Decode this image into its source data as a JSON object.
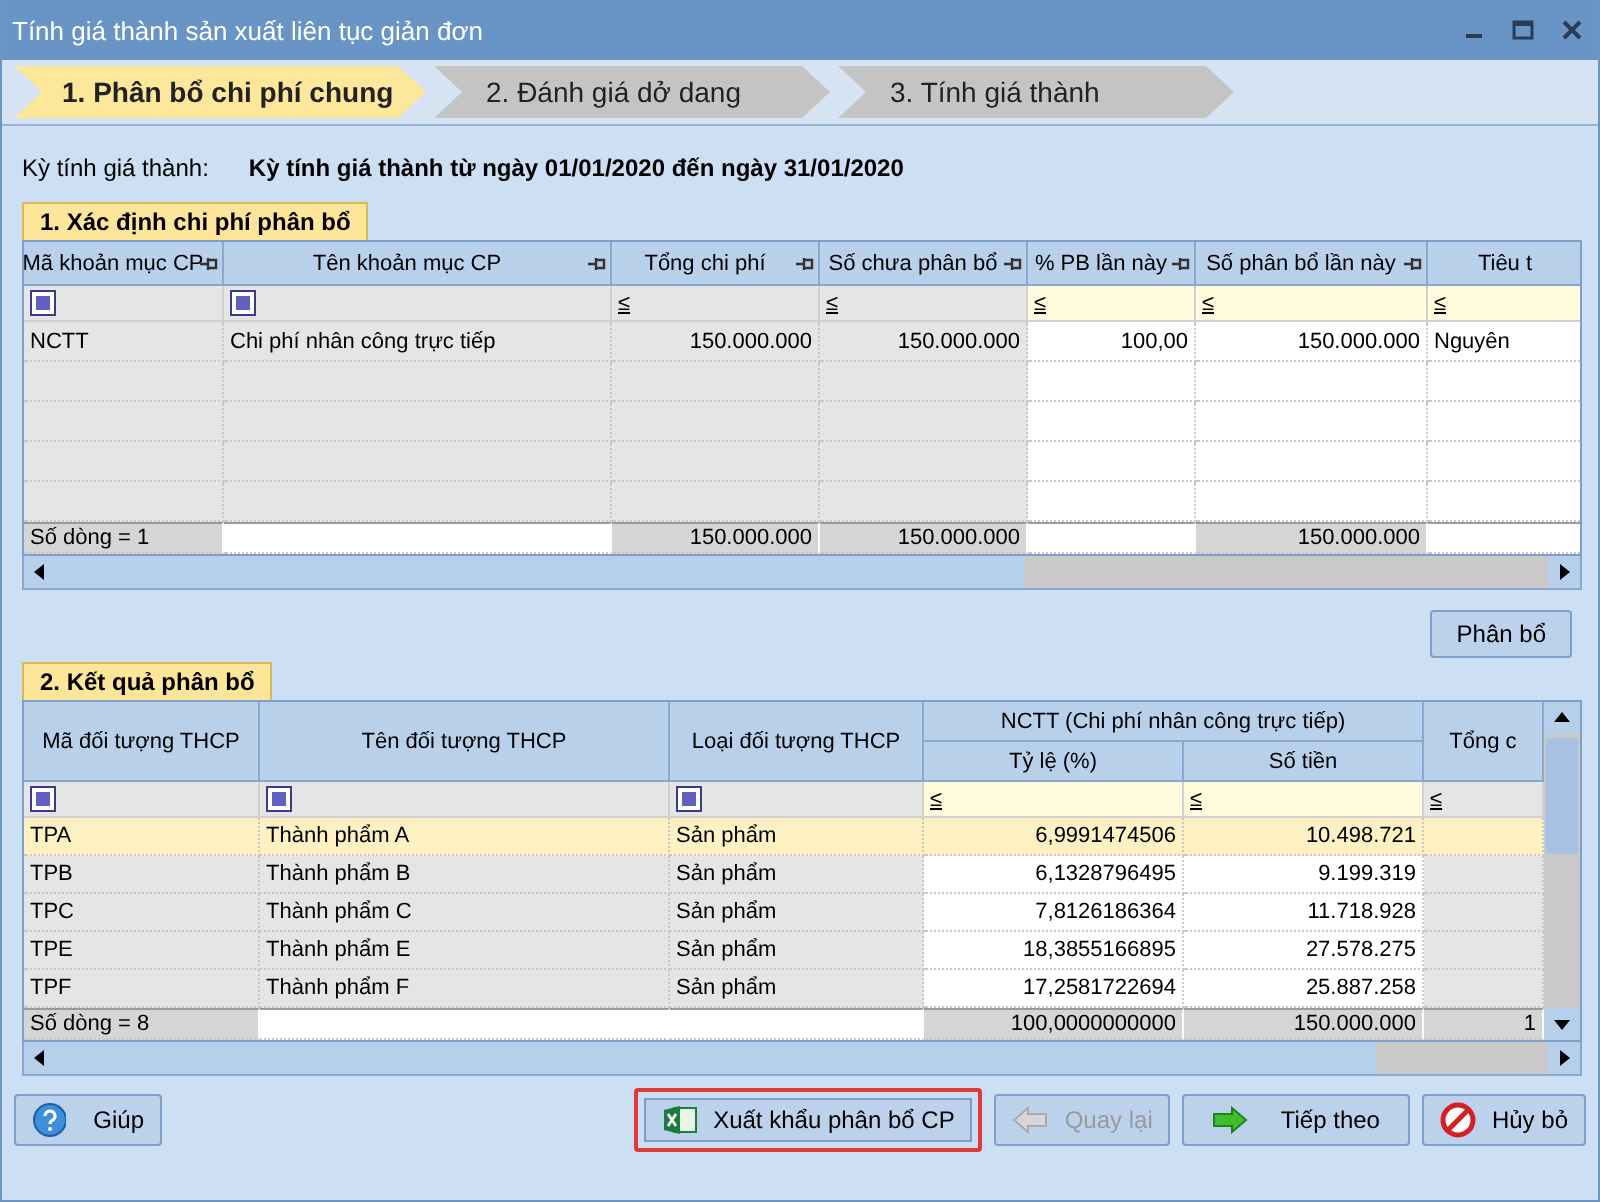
{
  "window": {
    "title": "Tính giá thành sản xuất liên tục giản đơn"
  },
  "steps": [
    {
      "label": "1. Phân bổ chi phí chung",
      "selected": true
    },
    {
      "label": "2. Đánh giá dở dang",
      "selected": false
    },
    {
      "label": "3. Tính giá thành",
      "selected": false
    }
  ],
  "period": {
    "label": "Kỳ tính giá thành:",
    "value": "Kỳ tính giá thành từ ngày 01/01/2020 đến ngày 31/01/2020"
  },
  "section1": {
    "title": "1. Xác định chi phí phân bổ",
    "columns": [
      {
        "label": "Mã khoản mục CP",
        "filter": {
          "kind": "checkbox"
        },
        "editable": false
      },
      {
        "label": "Tên khoản mục CP",
        "filter": {
          "kind": "checkbox"
        },
        "editable": false
      },
      {
        "label": "Tổng chi phí",
        "filter": {
          "kind": "operator",
          "text": "≤"
        },
        "editable": false
      },
      {
        "label": "Số chưa phân bổ",
        "filter": {
          "kind": "operator",
          "text": "≤"
        },
        "editable": false
      },
      {
        "label": "% PB lần này",
        "filter": {
          "kind": "operator",
          "text": "≤"
        },
        "editable": true
      },
      {
        "label": "Số phân bổ lần này",
        "filter": {
          "kind": "operator",
          "text": "≤"
        },
        "editable": true
      },
      {
        "label": "Tiêu t",
        "filter": {
          "kind": "operator",
          "text": "≤"
        },
        "editable": true
      }
    ],
    "rows": [
      [
        "NCTT",
        "Chi phí nhân công trực tiếp",
        "150.000.000",
        "150.000.000",
        "100,00",
        "150.000.000",
        "Nguyên"
      ]
    ],
    "footer": [
      {
        "kind": "value",
        "text": "Số dòng = 1"
      },
      {
        "kind": "blank"
      },
      {
        "kind": "value",
        "text": "150.000.000"
      },
      {
        "kind": "value",
        "text": "150.000.000"
      },
      {
        "kind": "blank"
      },
      {
        "kind": "value",
        "text": "150.000.000"
      },
      {
        "kind": "blank"
      }
    ]
  },
  "allocate_button": "Phân bổ",
  "section2": {
    "title": "2. Kết quả phân bổ",
    "columns": [
      {
        "label": "Mã đối tượng THCP",
        "filter": {
          "kind": "checkbox"
        },
        "editable": false
      },
      {
        "label": "Tên đối tượng THCP",
        "filter": {
          "kind": "checkbox"
        },
        "editable": false
      },
      {
        "label": "Loại đối tượng THCP",
        "filter": {
          "kind": "checkbox"
        },
        "editable": false
      },
      {
        "group": "NCTT (Chi phí nhân công trực tiếp)",
        "columns": [
          {
            "label": "Tỷ lệ (%)",
            "filter": {
              "kind": "operator",
              "text": "≤"
            },
            "editable": true
          },
          {
            "label": "Số tiền",
            "filter": {
              "kind": "operator",
              "text": "≤"
            },
            "editable": true
          }
        ]
      },
      {
        "label": "Tổng c",
        "filter": {
          "kind": "operator",
          "text": "≤"
        },
        "editable": false
      }
    ],
    "rows": [
      {
        "cells": [
          "TPA",
          "Thành phẩm A",
          "Sản phẩm",
          "6,9991474506",
          "10.498.721",
          null
        ],
        "selected": true
      },
      {
        "cells": [
          "TPB",
          "Thành phẩm B",
          "Sản phẩm",
          "6,1328796495",
          "9.199.319",
          null
        ],
        "selected": false
      },
      {
        "cells": [
          "TPC",
          "Thành phẩm C",
          "Sản phẩm",
          "7,8126186364",
          "11.718.928",
          null
        ],
        "selected": false
      },
      {
        "cells": [
          "TPE",
          "Thành phẩm E",
          "Sản phẩm",
          "18,3855166895",
          "27.578.275",
          null
        ],
        "selected": false
      },
      {
        "cells": [
          "TPF",
          "Thành phẩm F",
          "Sản phẩm",
          "17,2581722694",
          "25.887.258",
          null
        ],
        "selected": false
      }
    ],
    "footer": [
      {
        "kind": "value",
        "text": "Số dòng = 8"
      },
      {
        "kind": "blank"
      },
      {
        "kind": "blank"
      },
      {
        "kind": "value",
        "text": "100,0000000000"
      },
      {
        "kind": "value",
        "text": "150.000.000"
      },
      {
        "kind": "value",
        "text": "1"
      }
    ]
  },
  "buttons": [
    {
      "kind": "help",
      "label": "Giúp",
      "disabled": false,
      "highlighted": false
    },
    {
      "kind": "export",
      "label": "Xuất khẩu phân bổ CP",
      "disabled": false,
      "highlighted": true
    },
    {
      "kind": "back",
      "label": "Quay lại",
      "disabled": true,
      "highlighted": false
    },
    {
      "kind": "next",
      "label": "Tiếp theo",
      "disabled": false,
      "highlighted": false
    },
    {
      "kind": "cancel",
      "label": "Hủy bỏ",
      "disabled": false,
      "highlighted": false
    }
  ]
}
